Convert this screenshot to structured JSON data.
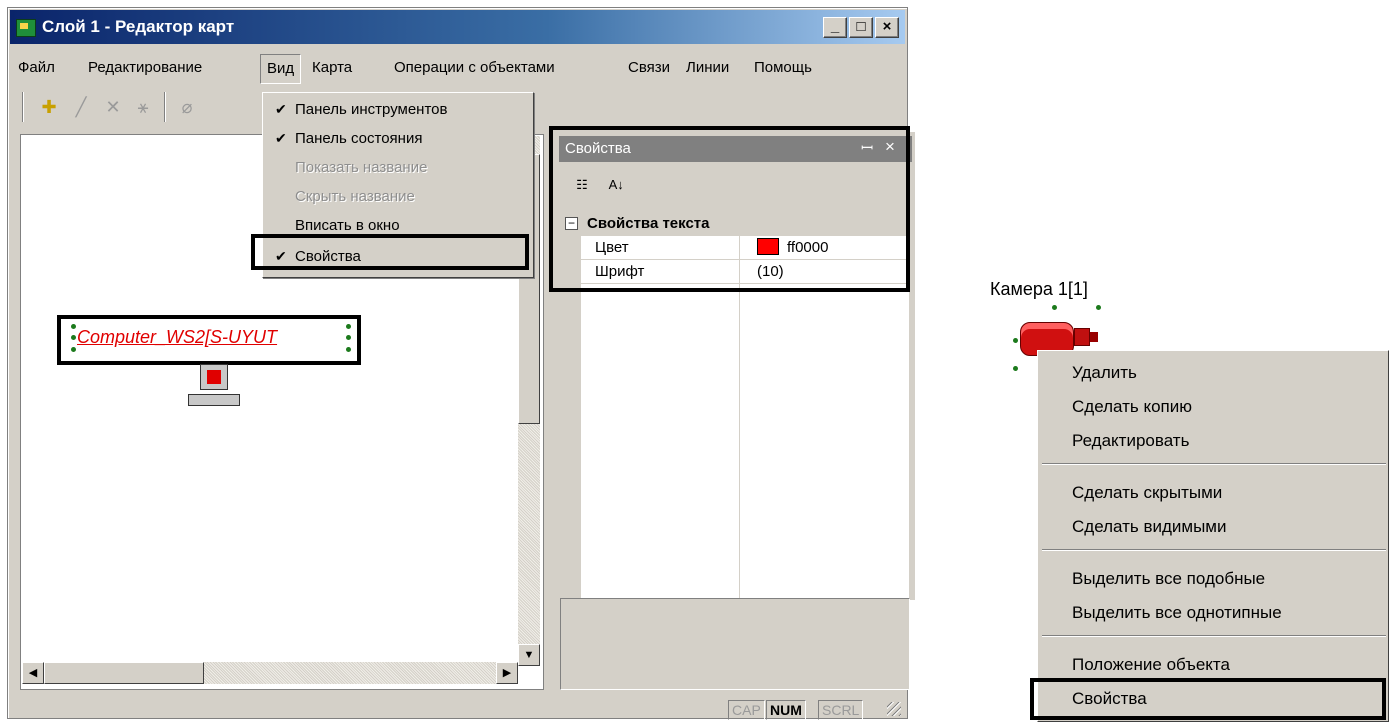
{
  "window": {
    "title": "Слой 1 - Редактор карт",
    "controls": {
      "minimize": "_",
      "maximize": "□",
      "close": "×"
    }
  },
  "menubar": [
    "Файл",
    "Редактирование",
    "Вид",
    "Карта",
    "Операции с объектами",
    "Связи",
    "Линии",
    "Помощь"
  ],
  "toolbar": {
    "icons": [
      "add-point-icon",
      "draw-line-icon",
      "delete-icon",
      "add-link-icon",
      "eraser-icon"
    ]
  },
  "view_menu": {
    "items": [
      {
        "label": "Панель инструментов",
        "checked": true,
        "enabled": true
      },
      {
        "label": "Панель состояния",
        "checked": true,
        "enabled": true
      },
      {
        "label": "Показать название",
        "checked": false,
        "enabled": false
      },
      {
        "label": "Скрыть название",
        "checked": false,
        "enabled": false
      },
      {
        "label": "Вписать в окно",
        "checked": false,
        "enabled": true
      },
      {
        "label": "Свойства",
        "checked": true,
        "enabled": true
      }
    ]
  },
  "canvas": {
    "object_label": "Computer_WS2[S-UYUT",
    "colors": {
      "label": "#e00000"
    }
  },
  "properties": {
    "title": "Свойства",
    "pin": "ꟷ",
    "close": "×",
    "category": "Свойства текста",
    "rows": [
      {
        "name": "Цвет",
        "value": "ff0000",
        "swatch": "#ff0000"
      },
      {
        "name": "Шрифт",
        "value": "(10)"
      }
    ]
  },
  "statusbar": [
    "CAP",
    "NUM",
    "SCRL"
  ],
  "camera": {
    "label": "Камера 1[1]"
  },
  "context_menu": {
    "groups": [
      [
        "Удалить",
        "Сделать копию",
        "Редактировать"
      ],
      [
        "Сделать скрытыми",
        "Сделать видимыми"
      ],
      [
        "Выделить все подобные",
        "Выделить все однотипные"
      ],
      [
        "Положение объекта",
        "Свойства"
      ]
    ]
  }
}
